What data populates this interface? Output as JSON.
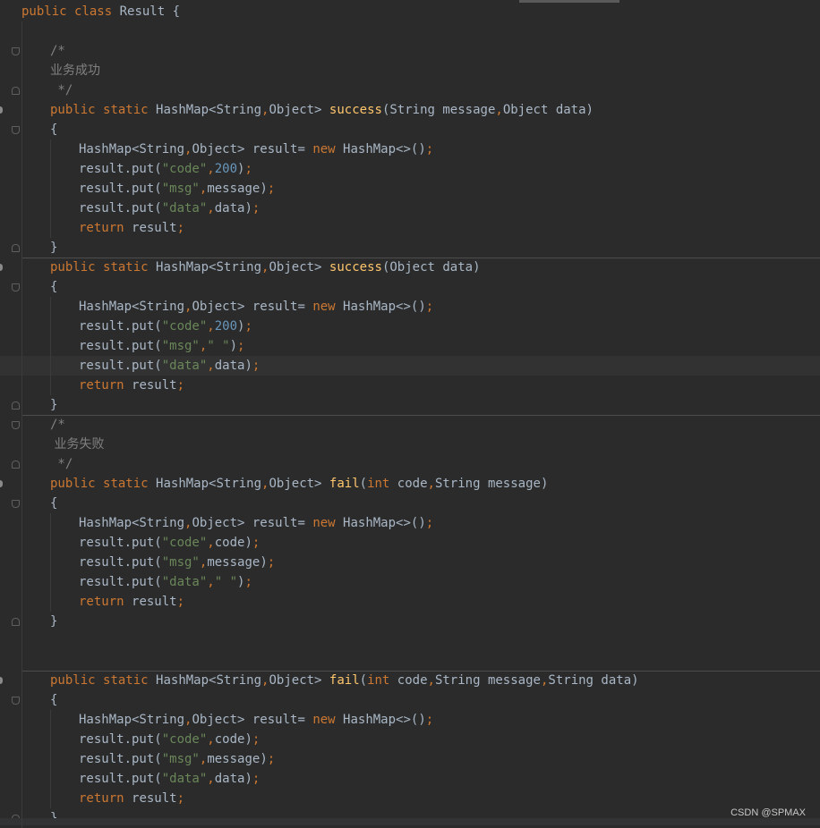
{
  "editor": {
    "lines": [
      {
        "indent": 0,
        "tokens": [
          {
            "t": "public ",
            "c": "k"
          },
          {
            "t": "class ",
            "c": "k"
          },
          {
            "t": "Result {",
            "c": "p"
          }
        ]
      },
      {
        "indent": 0,
        "tokens": []
      },
      {
        "indent": 1,
        "tokens": [
          {
            "t": "/*",
            "c": "c"
          }
        ]
      },
      {
        "indent": 1,
        "tokens": [
          {
            "t": "业务成功",
            "c": "c cmt-cjk"
          }
        ]
      },
      {
        "indent": 1,
        "tokens": [
          {
            "t": " */",
            "c": "c"
          }
        ]
      },
      {
        "indent": 1,
        "tokens": [
          {
            "t": "public ",
            "c": "k"
          },
          {
            "t": "static ",
            "c": "k"
          },
          {
            "t": "HashMap<String",
            "c": "p"
          },
          {
            "t": ",",
            "c": "k"
          },
          {
            "t": "Object> ",
            "c": "p"
          },
          {
            "t": "success",
            "c": "m"
          },
          {
            "t": "(String message",
            "c": "p"
          },
          {
            "t": ",",
            "c": "k"
          },
          {
            "t": "Object data)",
            "c": "p"
          }
        ]
      },
      {
        "indent": 1,
        "tokens": [
          {
            "t": "{",
            "c": "p"
          }
        ]
      },
      {
        "indent": 2,
        "tokens": [
          {
            "t": "HashMap<String",
            "c": "p"
          },
          {
            "t": ",",
            "c": "k"
          },
          {
            "t": "Object> result= ",
            "c": "p"
          },
          {
            "t": "new ",
            "c": "k"
          },
          {
            "t": "HashMap<>()",
            "c": "p"
          },
          {
            "t": ";",
            "c": "k"
          }
        ]
      },
      {
        "indent": 2,
        "tokens": [
          {
            "t": "result.put(",
            "c": "p"
          },
          {
            "t": "\"code\"",
            "c": "s"
          },
          {
            "t": ",",
            "c": "k"
          },
          {
            "t": "200",
            "c": "n"
          },
          {
            "t": ")",
            "c": "p"
          },
          {
            "t": ";",
            "c": "k"
          }
        ]
      },
      {
        "indent": 2,
        "tokens": [
          {
            "t": "result.put(",
            "c": "p"
          },
          {
            "t": "\"msg\"",
            "c": "s"
          },
          {
            "t": ",",
            "c": "k"
          },
          {
            "t": "message)",
            "c": "p"
          },
          {
            "t": ";",
            "c": "k"
          }
        ]
      },
      {
        "indent": 2,
        "tokens": [
          {
            "t": "result.put(",
            "c": "p"
          },
          {
            "t": "\"data\"",
            "c": "s"
          },
          {
            "t": ",",
            "c": "k"
          },
          {
            "t": "data)",
            "c": "p"
          },
          {
            "t": ";",
            "c": "k"
          }
        ]
      },
      {
        "indent": 2,
        "tokens": [
          {
            "t": "return ",
            "c": "k"
          },
          {
            "t": "result",
            "c": "p"
          },
          {
            "t": ";",
            "c": "k"
          }
        ]
      },
      {
        "indent": 1,
        "tokens": [
          {
            "t": "}",
            "c": "p"
          }
        ]
      },
      {
        "indent": 1,
        "tokens": [
          {
            "t": "public ",
            "c": "k"
          },
          {
            "t": "static ",
            "c": "k"
          },
          {
            "t": "HashMap<String",
            "c": "p"
          },
          {
            "t": ",",
            "c": "k"
          },
          {
            "t": "Object> ",
            "c": "p"
          },
          {
            "t": "success",
            "c": "m"
          },
          {
            "t": "(Object data)",
            "c": "p"
          }
        ]
      },
      {
        "indent": 1,
        "tokens": [
          {
            "t": "{",
            "c": "p"
          }
        ]
      },
      {
        "indent": 2,
        "tokens": [
          {
            "t": "HashMap<String",
            "c": "p"
          },
          {
            "t": ",",
            "c": "k"
          },
          {
            "t": "Object> result= ",
            "c": "p"
          },
          {
            "t": "new ",
            "c": "k"
          },
          {
            "t": "HashMap<>()",
            "c": "p"
          },
          {
            "t": ";",
            "c": "k"
          }
        ]
      },
      {
        "indent": 2,
        "tokens": [
          {
            "t": "result.put(",
            "c": "p"
          },
          {
            "t": "\"code\"",
            "c": "s"
          },
          {
            "t": ",",
            "c": "k"
          },
          {
            "t": "200",
            "c": "n"
          },
          {
            "t": ")",
            "c": "p"
          },
          {
            "t": ";",
            "c": "k"
          }
        ]
      },
      {
        "indent": 2,
        "tokens": [
          {
            "t": "result.put(",
            "c": "p"
          },
          {
            "t": "\"msg\"",
            "c": "s"
          },
          {
            "t": ",",
            "c": "k"
          },
          {
            "t": "\" \"",
            "c": "s"
          },
          {
            "t": ")",
            "c": "p"
          },
          {
            "t": ";",
            "c": "k"
          }
        ]
      },
      {
        "indent": 2,
        "current": true,
        "tokens": [
          {
            "t": "result.put(",
            "c": "p"
          },
          {
            "t": "\"data\"",
            "c": "s"
          },
          {
            "t": ",",
            "c": "k"
          },
          {
            "t": "data)",
            "c": "p"
          },
          {
            "t": ";",
            "c": "k"
          }
        ]
      },
      {
        "indent": 2,
        "tokens": [
          {
            "t": "return ",
            "c": "k"
          },
          {
            "t": "result",
            "c": "p"
          },
          {
            "t": ";",
            "c": "k"
          }
        ]
      },
      {
        "indent": 1,
        "tokens": [
          {
            "t": "}",
            "c": "p"
          }
        ]
      },
      {
        "indent": 1,
        "tokens": [
          {
            "t": "/*",
            "c": "c"
          }
        ]
      },
      {
        "indent": 1,
        "tokens": [
          {
            "t": " 业务失败",
            "c": "c cmt-cjk"
          }
        ]
      },
      {
        "indent": 1,
        "tokens": [
          {
            "t": " */",
            "c": "c"
          }
        ]
      },
      {
        "indent": 1,
        "tokens": [
          {
            "t": "public ",
            "c": "k"
          },
          {
            "t": "static ",
            "c": "k"
          },
          {
            "t": "HashMap<String",
            "c": "p"
          },
          {
            "t": ",",
            "c": "k"
          },
          {
            "t": "Object> ",
            "c": "p"
          },
          {
            "t": "fail",
            "c": "m"
          },
          {
            "t": "(",
            "c": "p"
          },
          {
            "t": "int ",
            "c": "k"
          },
          {
            "t": "code",
            "c": "p"
          },
          {
            "t": ",",
            "c": "k"
          },
          {
            "t": "String message)",
            "c": "p"
          }
        ]
      },
      {
        "indent": 1,
        "tokens": [
          {
            "t": "{",
            "c": "p"
          }
        ]
      },
      {
        "indent": 2,
        "tokens": [
          {
            "t": "HashMap<String",
            "c": "p"
          },
          {
            "t": ",",
            "c": "k"
          },
          {
            "t": "Object> result= ",
            "c": "p"
          },
          {
            "t": "new ",
            "c": "k"
          },
          {
            "t": "HashMap<>()",
            "c": "p"
          },
          {
            "t": ";",
            "c": "k"
          }
        ]
      },
      {
        "indent": 2,
        "tokens": [
          {
            "t": "result.put(",
            "c": "p"
          },
          {
            "t": "\"code\"",
            "c": "s"
          },
          {
            "t": ",",
            "c": "k"
          },
          {
            "t": "code)",
            "c": "p"
          },
          {
            "t": ";",
            "c": "k"
          }
        ]
      },
      {
        "indent": 2,
        "tokens": [
          {
            "t": "result.put(",
            "c": "p"
          },
          {
            "t": "\"msg\"",
            "c": "s"
          },
          {
            "t": ",",
            "c": "k"
          },
          {
            "t": "message)",
            "c": "p"
          },
          {
            "t": ";",
            "c": "k"
          }
        ]
      },
      {
        "indent": 2,
        "tokens": [
          {
            "t": "result.put(",
            "c": "p"
          },
          {
            "t": "\"data\"",
            "c": "s"
          },
          {
            "t": ",",
            "c": "k"
          },
          {
            "t": "\" \"",
            "c": "s"
          },
          {
            "t": ")",
            "c": "p"
          },
          {
            "t": ";",
            "c": "k"
          }
        ]
      },
      {
        "indent": 2,
        "tokens": [
          {
            "t": "return ",
            "c": "k"
          },
          {
            "t": "result",
            "c": "p"
          },
          {
            "t": ";",
            "c": "k"
          }
        ]
      },
      {
        "indent": 1,
        "tokens": [
          {
            "t": "}",
            "c": "p"
          }
        ]
      },
      {
        "indent": 0,
        "tokens": []
      },
      {
        "indent": 0,
        "tokens": []
      },
      {
        "indent": 1,
        "tokens": [
          {
            "t": "public ",
            "c": "k"
          },
          {
            "t": "static ",
            "c": "k"
          },
          {
            "t": "HashMap<String",
            "c": "p"
          },
          {
            "t": ",",
            "c": "k"
          },
          {
            "t": "Object> ",
            "c": "p"
          },
          {
            "t": "fail",
            "c": "m"
          },
          {
            "t": "(",
            "c": "p"
          },
          {
            "t": "int ",
            "c": "k"
          },
          {
            "t": "code",
            "c": "p"
          },
          {
            "t": ",",
            "c": "k"
          },
          {
            "t": "String message",
            "c": "p"
          },
          {
            "t": ",",
            "c": "k"
          },
          {
            "t": "String data)",
            "c": "p"
          }
        ]
      },
      {
        "indent": 1,
        "tokens": [
          {
            "t": "{",
            "c": "p"
          }
        ]
      },
      {
        "indent": 2,
        "tokens": [
          {
            "t": "HashMap<String",
            "c": "p"
          },
          {
            "t": ",",
            "c": "k"
          },
          {
            "t": "Object> result= ",
            "c": "p"
          },
          {
            "t": "new ",
            "c": "k"
          },
          {
            "t": "HashMap<>()",
            "c": "p"
          },
          {
            "t": ";",
            "c": "k"
          }
        ]
      },
      {
        "indent": 2,
        "tokens": [
          {
            "t": "result.put(",
            "c": "p"
          },
          {
            "t": "\"code\"",
            "c": "s"
          },
          {
            "t": ",",
            "c": "k"
          },
          {
            "t": "code)",
            "c": "p"
          },
          {
            "t": ";",
            "c": "k"
          }
        ]
      },
      {
        "indent": 2,
        "tokens": [
          {
            "t": "result.put(",
            "c": "p"
          },
          {
            "t": "\"msg\"",
            "c": "s"
          },
          {
            "t": ",",
            "c": "k"
          },
          {
            "t": "message)",
            "c": "p"
          },
          {
            "t": ";",
            "c": "k"
          }
        ]
      },
      {
        "indent": 2,
        "tokens": [
          {
            "t": "result.put(",
            "c": "p"
          },
          {
            "t": "\"data\"",
            "c": "s"
          },
          {
            "t": ",",
            "c": "k"
          },
          {
            "t": "data)",
            "c": "p"
          },
          {
            "t": ";",
            "c": "k"
          }
        ]
      },
      {
        "indent": 2,
        "tokens": [
          {
            "t": "return ",
            "c": "k"
          },
          {
            "t": "result",
            "c": "p"
          },
          {
            "t": ";",
            "c": "k"
          }
        ]
      },
      {
        "indent": 1,
        "tokens": [
          {
            "t": "}",
            "c": "p"
          }
        ]
      }
    ]
  },
  "watermark": "CSDN @SPMAX",
  "colors": {
    "background": "#2b2b2b",
    "keyword": "#cc7832",
    "string": "#6a8759",
    "number": "#6897bb",
    "method": "#ffc66d",
    "comment": "#808080",
    "text": "#a9b7c6"
  }
}
